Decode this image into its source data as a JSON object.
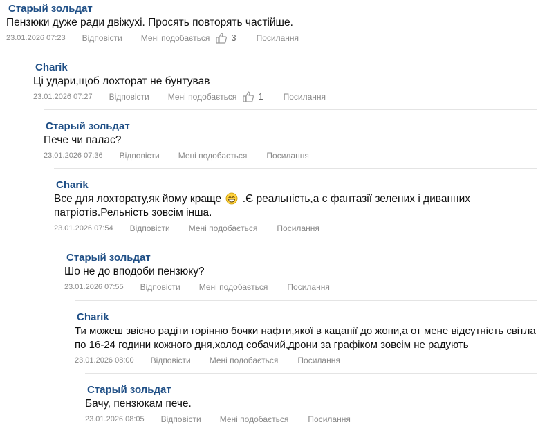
{
  "comments": [
    {
      "author": "Старый зольдат",
      "text": "Пензюки дуже ради двіжухі. Просять повторять частійше.",
      "date": "23.01.2026 07:23",
      "reply": "Відповісти",
      "like": "Мені подобається",
      "likes": "3",
      "link": "Посилання"
    },
    {
      "author": "Charik",
      "text": "Ці удари,щоб лохторат не бунтував",
      "date": "23.01.2026 07:27",
      "reply": "Відповісти",
      "like": "Мені подобається",
      "likes": "1",
      "link": "Посилання"
    },
    {
      "author": "Старый зольдат",
      "text": "Пече чи палає?",
      "date": "23.01.2026 07:36",
      "reply": "Відповісти",
      "like": "Мені подобається",
      "link": "Посилання"
    },
    {
      "author": "Charik",
      "text_before_emoji": "Все для лохторату,як йому краще",
      "emoji": "smiling-face-icon",
      "text_after_emoji": ".Є реальність,а є фантазії зелених і диванних патріотів.Рельність зовсім інша.",
      "date": "23.01.2026 07:54",
      "reply": "Відповісти",
      "like": "Мені подобається",
      "link": "Посилання"
    },
    {
      "author": "Старый зольдат",
      "text": "Шо не до вподоби пензюку?",
      "date": "23.01.2026 07:55",
      "reply": "Відповісти",
      "like": "Мені подобається",
      "link": "Посилання"
    },
    {
      "author": "Charik",
      "text": "Ти можеш звісно радіти горінню бочки нафти,якої в кацапії до жопи,а от мене відсутність світла по 16-24 години кожного дня,холод собачий,дрони за графіком зовсім не радують",
      "date": "23.01.2026 08:00",
      "reply": "Відповісти",
      "like": "Мені подобається",
      "link": "Посилання"
    },
    {
      "author": "Старый зольдат",
      "text": "Бачу, пензюкам пече.",
      "date": "23.01.2026 08:05",
      "reply": "Відповісти",
      "like": "Мені подобається",
      "link": "Посилання"
    }
  ],
  "colors": {
    "author": "#1f4f86",
    "meta": "#8a8a8a",
    "separator": "#e4e4e4"
  }
}
